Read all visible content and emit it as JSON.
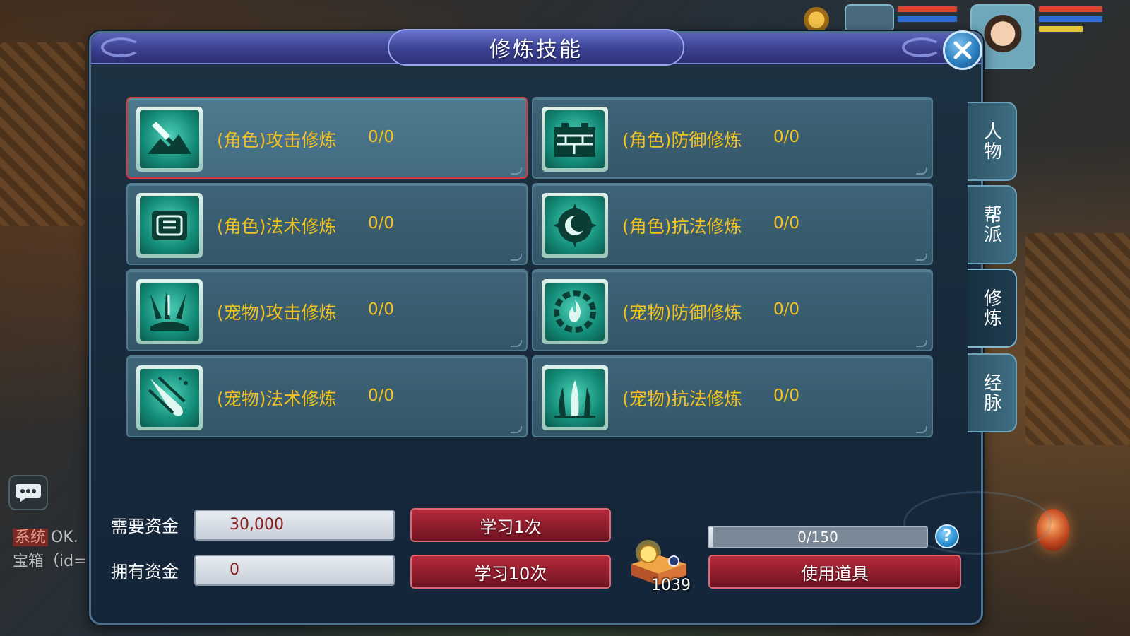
{
  "window": {
    "title": "修炼技能"
  },
  "skills": [
    {
      "name": "(角色)攻击修炼",
      "value": "0/0",
      "icon": "sword-mountain-icon",
      "selected": true
    },
    {
      "name": "(角色)防御修炼",
      "value": "0/0",
      "icon": "fortress-wall-icon",
      "selected": false
    },
    {
      "name": "(角色)法术修炼",
      "value": "0/0",
      "icon": "spell-scroll-icon",
      "selected": false
    },
    {
      "name": "(角色)抗法修炼",
      "value": "0/0",
      "icon": "crescent-sun-icon",
      "selected": false
    },
    {
      "name": "(宠物)攻击修炼",
      "value": "0/0",
      "icon": "claw-blades-icon",
      "selected": false
    },
    {
      "name": "(宠物)防御修炼",
      "value": "0/0",
      "icon": "flame-ring-icon",
      "selected": false
    },
    {
      "name": "(宠物)法术修炼",
      "value": "0/0",
      "icon": "comet-icon",
      "selected": false
    },
    {
      "name": "(宠物)抗法修炼",
      "value": "0/0",
      "icon": "fountain-icon",
      "selected": false
    }
  ],
  "side_tabs": [
    {
      "label": "人物",
      "active": false
    },
    {
      "label": "帮派",
      "active": false
    },
    {
      "label": "修炼",
      "active": true
    },
    {
      "label": "经脉",
      "active": false
    }
  ],
  "funds": {
    "required_label": "需要资金",
    "required_value": "30,000",
    "owned_label": "拥有资金",
    "owned_value": "0"
  },
  "buttons": {
    "learn_once": "学习1次",
    "learn_ten": "学习10次",
    "use_item": "使用道具"
  },
  "item": {
    "count": "1039",
    "icon": "treasure-chest-icon"
  },
  "progress": {
    "text": "0/150",
    "fraction": 0.0
  },
  "help": {
    "label": "?"
  },
  "chat": {
    "line1_tag": "系统",
    "line1": "OK.",
    "line2": "宝箱（id="
  },
  "colors": {
    "skill_text": "#f3c21f",
    "selected_border": "#d53a3a",
    "header": "#3b3f8f",
    "button_red": "#8e1d2c"
  }
}
